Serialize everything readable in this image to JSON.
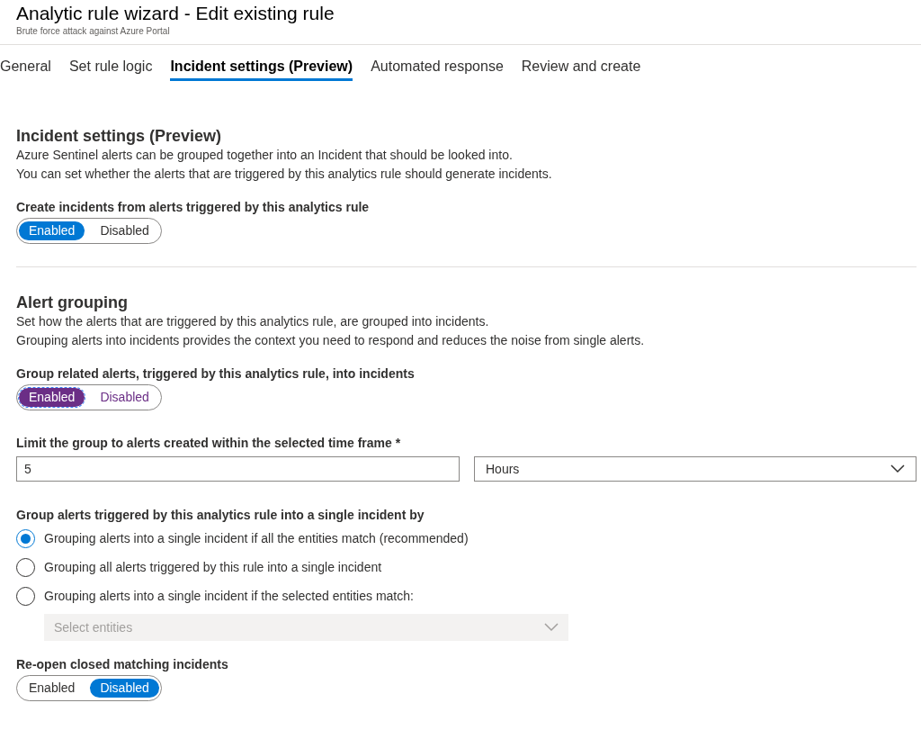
{
  "header": {
    "title": "Analytic rule wizard - Edit existing rule",
    "subtitle": "Brute force attack against Azure Portal"
  },
  "tabs": [
    {
      "label": "General",
      "selected": false
    },
    {
      "label": "Set rule logic",
      "selected": false
    },
    {
      "label": "Incident settings (Preview)",
      "selected": true
    },
    {
      "label": "Automated response",
      "selected": false
    },
    {
      "label": "Review and create",
      "selected": false
    }
  ],
  "incident_settings": {
    "title": "Incident settings (Preview)",
    "description": [
      "Azure Sentinel alerts can be grouped together into an Incident that should be looked into.",
      "You can set whether the alerts that are triggered by this analytics rule should generate incidents."
    ],
    "create_incidents": {
      "label": "Create incidents from alerts triggered by this analytics rule",
      "options": [
        {
          "label": "Enabled",
          "selected": true
        },
        {
          "label": "Disabled",
          "selected": false
        }
      ],
      "focused": false
    }
  },
  "alert_grouping": {
    "title": "Alert grouping",
    "description": [
      "Set how the alerts that are triggered by this analytics rule, are grouped into incidents.",
      "Grouping alerts into incidents provides the context you need to respond and reduces the noise from single alerts."
    ],
    "group_related": {
      "label": "Group related alerts, triggered by this analytics rule, into incidents",
      "options": [
        {
          "label": "Enabled",
          "selected": true
        },
        {
          "label": "Disabled",
          "selected": false
        }
      ],
      "focused": true
    },
    "time_frame": {
      "label": "Limit the group to alerts created within the selected time frame",
      "required_mark": "*",
      "value": "5",
      "unit": "Hours"
    },
    "group_by": {
      "label": "Group alerts triggered by this analytics rule into a single incident by",
      "options": [
        {
          "label": "Grouping alerts into a single incident if all the entities match (recommended)",
          "selected": true
        },
        {
          "label": "Grouping all alerts triggered by this rule into a single incident",
          "selected": false
        },
        {
          "label": "Grouping alerts into a single incident if the selected entities match:",
          "selected": false
        }
      ],
      "entities": {
        "placeholder": "Select entities",
        "disabled": true
      }
    },
    "reopen": {
      "label": "Re-open closed matching incidents",
      "options": [
        {
          "label": "Enabled",
          "selected": false
        },
        {
          "label": "Disabled",
          "selected": true
        }
      ],
      "focused": false
    }
  }
}
